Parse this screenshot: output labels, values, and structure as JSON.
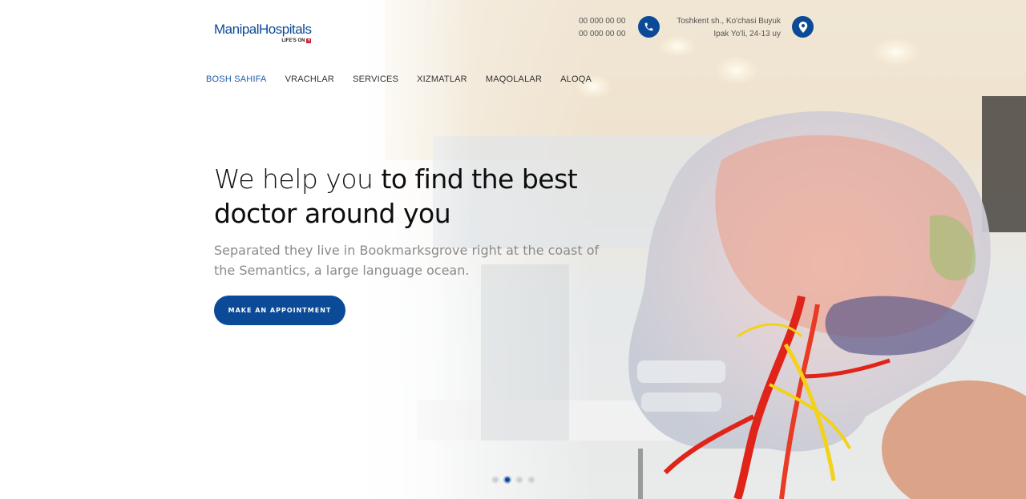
{
  "brand": {
    "name": "ManipalHospitals",
    "tagline": "LIFE'S ON",
    "accent": "#0a4a97",
    "tag_color": "#d6243a"
  },
  "contact": {
    "phone_1": "00 000 00 00",
    "phone_2": "00 000 00 00",
    "address_line_1": "Toshkent sh., Ko'chasi Buyuk",
    "address_line_2": "Ipak Yo'li, 24-13 uy",
    "phone_icon": "phone-icon",
    "location_icon": "map-pin-icon"
  },
  "nav": {
    "items": [
      {
        "label": "BOSH SAHIFA",
        "active": true
      },
      {
        "label": "VRACHLAR",
        "active": false
      },
      {
        "label": "SERVICES",
        "active": false
      },
      {
        "label": "XIZMATLAR",
        "active": false
      },
      {
        "label": "MAQOLALAR",
        "active": false
      },
      {
        "label": "ALOQA",
        "active": false
      }
    ]
  },
  "hero": {
    "headline_light": "We help you ",
    "headline_strong": "to find the best doctor around you",
    "subtitle": "Separated they live in Bookmarksgrove right at the coast of the Semantics, a large language ocean.",
    "cta_label": "MAKE AN APPOINTMENT"
  },
  "slider": {
    "count": 4,
    "active_index": 1
  }
}
